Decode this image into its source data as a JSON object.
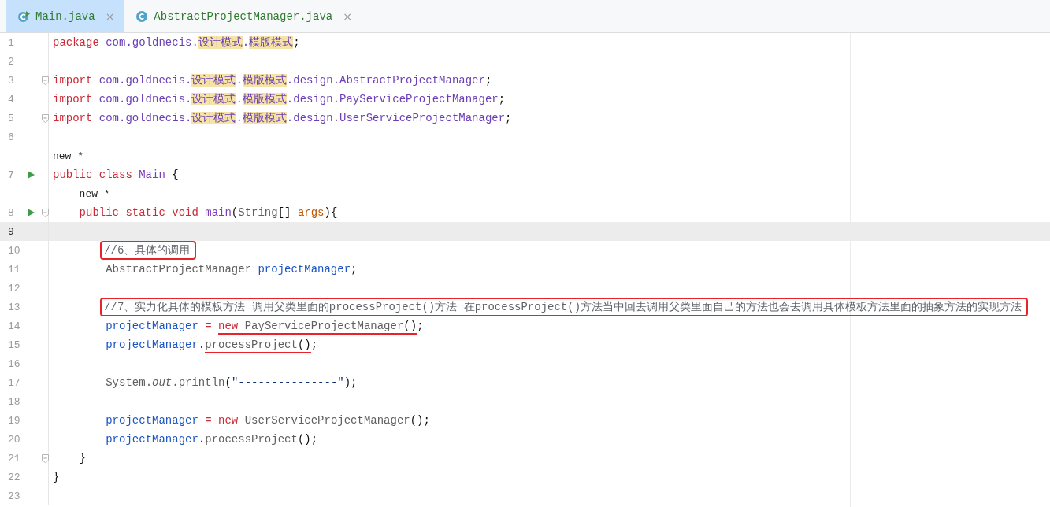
{
  "tabs": [
    {
      "label": "Main.java",
      "selected": true,
      "runnable": true,
      "close": "×"
    },
    {
      "label": "AbstractProjectManager.java",
      "selected": false,
      "runnable": false,
      "close": "×"
    }
  ],
  "lines": [
    {
      "kind": "code",
      "number": "1",
      "run": false,
      "fold": false,
      "current": false,
      "boxed": false,
      "tokens": [
        {
          "kind": "kw",
          "text": "package "
        },
        {
          "kind": "pkg",
          "text": "com.goldnecis."
        },
        {
          "kind": "hl",
          "text": "设计模式"
        },
        {
          "kind": "pkg",
          "text": "."
        },
        {
          "kind": "hl",
          "text": "模版模式"
        },
        {
          "kind": "plain",
          "text": ";"
        }
      ]
    },
    {
      "kind": "code",
      "number": "2",
      "run": false,
      "fold": false,
      "current": false,
      "boxed": false
    },
    {
      "kind": "code",
      "number": "3",
      "run": false,
      "fold": true,
      "current": false,
      "boxed": false,
      "tokens": [
        {
          "kind": "kw",
          "text": "import "
        },
        {
          "kind": "pkg",
          "text": "com.goldnecis."
        },
        {
          "kind": "hl",
          "text": "设计模式"
        },
        {
          "kind": "pkg",
          "text": "."
        },
        {
          "kind": "hl",
          "text": "模版模式"
        },
        {
          "kind": "pkg",
          "text": ".design.AbstractProjectManager"
        },
        {
          "kind": "plain",
          "text": ";"
        }
      ]
    },
    {
      "kind": "code",
      "number": "4",
      "run": false,
      "fold": false,
      "current": false,
      "boxed": false,
      "tokens": [
        {
          "kind": "kw",
          "text": "import "
        },
        {
          "kind": "pkg",
          "text": "com.goldnecis."
        },
        {
          "kind": "hl",
          "text": "设计模式"
        },
        {
          "kind": "pkg",
          "text": "."
        },
        {
          "kind": "hl",
          "text": "模版模式"
        },
        {
          "kind": "pkg",
          "text": ".design.PayServiceProjectManager"
        },
        {
          "kind": "plain",
          "text": ";"
        }
      ]
    },
    {
      "kind": "code",
      "number": "5",
      "run": false,
      "fold": true,
      "current": false,
      "boxed": false,
      "tokens": [
        {
          "kind": "kw",
          "text": "import "
        },
        {
          "kind": "pkg",
          "text": "com.goldnecis."
        },
        {
          "kind": "hl",
          "text": "设计模式"
        },
        {
          "kind": "pkg",
          "text": "."
        },
        {
          "kind": "hl",
          "text": "模版模式"
        },
        {
          "kind": "pkg",
          "text": ".design.UserServiceProjectManager"
        },
        {
          "kind": "plain",
          "text": ";"
        }
      ]
    },
    {
      "kind": "code",
      "number": "6",
      "run": false,
      "fold": false,
      "current": false,
      "boxed": false
    },
    {
      "kind": "hint",
      "text": "new *"
    },
    {
      "kind": "code",
      "number": "7",
      "run": true,
      "fold": false,
      "current": false,
      "boxed": false,
      "tokens": [
        {
          "kind": "kw",
          "text": "public class "
        },
        {
          "kind": "decl",
          "text": "Main"
        },
        {
          "kind": "plain",
          "text": " {"
        }
      ],
      "children": [
        {
          "kind": "hint",
          "text": "new *"
        },
        {
          "kind": "code",
          "number": "8",
          "run": true,
          "fold": true,
          "current": false,
          "boxed": false,
          "tokens": [
            {
              "kind": "kw",
              "text": "public static void "
            },
            {
              "kind": "decl",
              "text": "main"
            },
            {
              "kind": "plain",
              "text": "("
            },
            {
              "kind": "type",
              "text": "String"
            },
            {
              "kind": "plain",
              "text": "[] "
            },
            {
              "kind": "param",
              "text": "args"
            },
            {
              "kind": "plain",
              "text": "){"
            }
          ],
          "children": [
            {
              "kind": "code",
              "number": "9",
              "run": false,
              "fold": false,
              "current": true,
              "boxed": false
            },
            {
              "kind": "code",
              "number": "10",
              "run": false,
              "fold": false,
              "current": false,
              "boxed": true,
              "tokens": [
                {
                  "kind": "comment",
                  "text": "//6、具体的调用"
                }
              ]
            },
            {
              "kind": "code",
              "number": "11",
              "run": false,
              "fold": false,
              "current": false,
              "boxed": false,
              "tokens": [
                {
                  "kind": "type",
                  "text": "AbstractProjectManager "
                },
                {
                  "kind": "var",
                  "text": "projectManager"
                },
                {
                  "kind": "plain",
                  "text": ";"
                }
              ]
            },
            {
              "kind": "code",
              "number": "12",
              "run": false,
              "fold": false,
              "current": false,
              "boxed": false
            },
            {
              "kind": "code",
              "number": "13",
              "run": false,
              "fold": false,
              "current": false,
              "boxed": true,
              "tokens": [
                {
                  "kind": "comment",
                  "text": "//7、实力化具体的模板方法 调用父类里面的processProject()方法 在processProject()方法当中回去调用父类里面自己的方法也会去调用具体模板方法里面的抽象方法的实现方法"
                }
              ]
            },
            {
              "kind": "code",
              "number": "14",
              "run": false,
              "fold": false,
              "current": false,
              "boxed": false,
              "tokens": [
                {
                  "kind": "var",
                  "text": "projectManager"
                },
                {
                  "kind": "kw",
                  "text": " = "
                },
                {
                  "kind": "kw",
                  "text": "new",
                  "underlined": true
                },
                {
                  "kind": "type",
                  "text": " PayServiceProjectManager",
                  "underlined": true
                },
                {
                  "kind": "plain",
                  "text": "()",
                  "underlined": true
                },
                {
                  "kind": "plain",
                  "text": ";"
                }
              ]
            },
            {
              "kind": "code",
              "number": "15",
              "run": false,
              "fold": false,
              "current": false,
              "boxed": false,
              "tokens": [
                {
                  "kind": "var",
                  "text": "projectManager"
                },
                {
                  "kind": "plain",
                  "text": "."
                },
                {
                  "kind": "type",
                  "text": "processProject",
                  "underlined": true
                },
                {
                  "kind": "plain",
                  "text": "()",
                  "underlined": true
                },
                {
                  "kind": "plain",
                  "text": ";"
                }
              ]
            },
            {
              "kind": "code",
              "number": "16",
              "run": false,
              "fold": false,
              "current": false,
              "boxed": false
            },
            {
              "kind": "code",
              "number": "17",
              "run": false,
              "fold": false,
              "current": false,
              "boxed": false,
              "tokens": [
                {
                  "kind": "type",
                  "text": "System."
                },
                {
                  "kind": "static",
                  "text": "out"
                },
                {
                  "kind": "type",
                  "text": ".println"
                },
                {
                  "kind": "plain",
                  "text": "("
                },
                {
                  "kind": "string",
                  "text": "\"---------------\""
                },
                {
                  "kind": "plain",
                  "text": ");"
                }
              ]
            },
            {
              "kind": "code",
              "number": "18",
              "run": false,
              "fold": false,
              "current": false,
              "boxed": false
            },
            {
              "kind": "code",
              "number": "19",
              "run": false,
              "fold": false,
              "current": false,
              "boxed": false,
              "tokens": [
                {
                  "kind": "var",
                  "text": "projectManager"
                },
                {
                  "kind": "kw",
                  "text": " = "
                },
                {
                  "kind": "kw",
                  "text": "new"
                },
                {
                  "kind": "type",
                  "text": " UserServiceProjectManager"
                },
                {
                  "kind": "plain",
                  "text": "();"
                }
              ]
            },
            {
              "kind": "code",
              "number": "20",
              "run": false,
              "fold": false,
              "current": false,
              "boxed": false,
              "tokens": [
                {
                  "kind": "var",
                  "text": "projectManager"
                },
                {
                  "kind": "plain",
                  "text": "."
                },
                {
                  "kind": "type",
                  "text": "processProject"
                },
                {
                  "kind": "plain",
                  "text": "();"
                }
              ]
            }
          ]
        },
        {
          "kind": "code",
          "number": "21",
          "run": false,
          "fold": true,
          "current": false,
          "boxed": false,
          "tokens": [
            {
              "kind": "plain",
              "text": "}"
            }
          ]
        }
      ]
    },
    {
      "kind": "code",
      "number": "22",
      "run": false,
      "fold": false,
      "current": false,
      "boxed": false,
      "tokens": [
        {
          "kind": "plain",
          "text": "}"
        }
      ]
    },
    {
      "kind": "code",
      "number": "23",
      "run": false,
      "fold": false,
      "current": false,
      "boxed": false
    }
  ]
}
